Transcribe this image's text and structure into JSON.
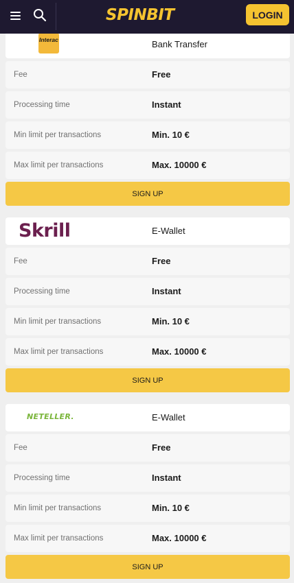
{
  "header": {
    "logo_text": "SPINBIT",
    "login_label": "LOGIN"
  },
  "methods": [
    {
      "logo_text": "Interac",
      "type": "Bank Transfer",
      "rows": [
        {
          "label": "Fee",
          "value": "Free"
        },
        {
          "label": "Processing time",
          "value": "Instant"
        },
        {
          "label": "Min limit per transactions",
          "value": "Min. 10 €"
        },
        {
          "label": "Max limit per transactions",
          "value": "Max. 10000 €"
        }
      ],
      "signup_label": "SIGN UP"
    },
    {
      "logo_text": "Skrill",
      "type": "E-Wallet",
      "rows": [
        {
          "label": "Fee",
          "value": "Free"
        },
        {
          "label": "Processing time",
          "value": "Instant"
        },
        {
          "label": "Min limit per transactions",
          "value": "Min. 10 €"
        },
        {
          "label": "Max limit per transactions",
          "value": "Max. 10000 €"
        }
      ],
      "signup_label": "SIGN UP"
    },
    {
      "logo_text": "NETELLER.",
      "type": "E-Wallet",
      "rows": [
        {
          "label": "Fee",
          "value": "Free"
        },
        {
          "label": "Processing time",
          "value": "Instant"
        },
        {
          "label": "Min limit per transactions",
          "value": "Min. 10 €"
        },
        {
          "label": "Max limit per transactions",
          "value": "Max. 10000 €"
        }
      ],
      "signup_label": "SIGN UP"
    }
  ]
}
